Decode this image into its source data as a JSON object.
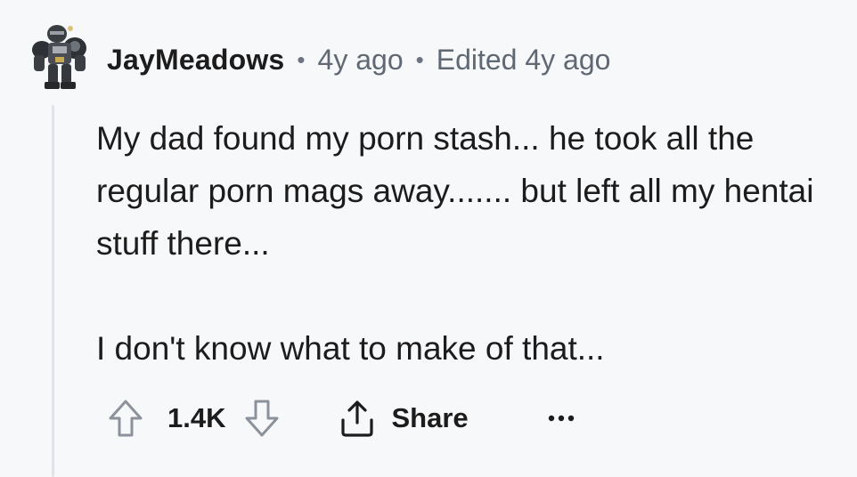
{
  "comment": {
    "author": "JayMeadows",
    "separator": "•",
    "age": "4y ago",
    "edited": "Edited 4y ago",
    "paragraphs": [
      "My dad found my porn stash... he took all the regular porn mags away....... but left all my hentai stuff there...",
      "I don't know what to make of that..."
    ]
  },
  "actions": {
    "upvote_icon": "arrow-up-outline-icon",
    "score": "1.4K",
    "downvote_icon": "arrow-down-outline-icon",
    "share_icon": "share-upload-icon",
    "share_label": "Share",
    "more_icon": "ellipsis-icon"
  },
  "colors": {
    "background": "#f7f8fa",
    "text": "#1c1c1c",
    "muted": "#5f6873",
    "thread_line": "#dfe3e8"
  }
}
